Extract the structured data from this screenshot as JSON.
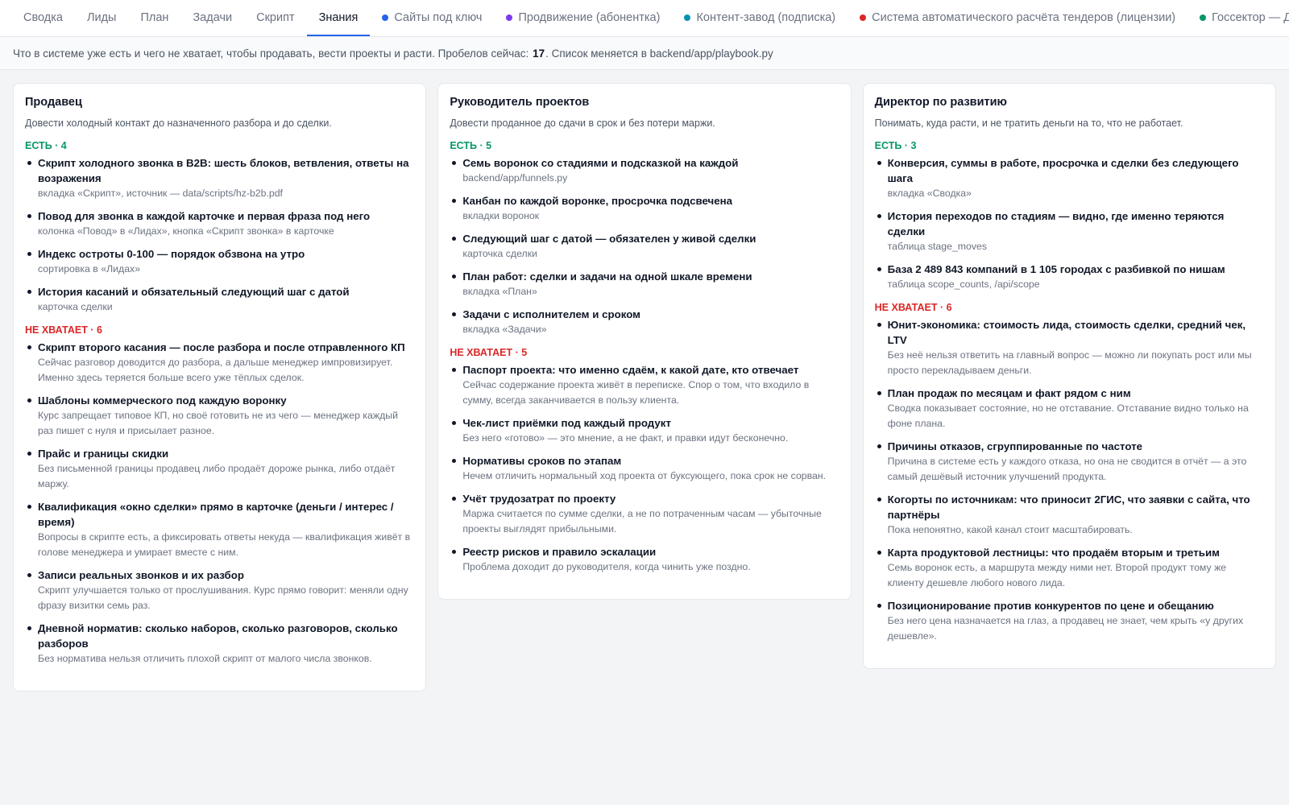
{
  "tabs": [
    {
      "label": "Сводка",
      "active": false
    },
    {
      "label": "Лиды",
      "active": false
    },
    {
      "label": "План",
      "active": false
    },
    {
      "label": "Задачи",
      "active": false
    },
    {
      "label": "Скрипт",
      "active": false
    },
    {
      "label": "Знания",
      "active": true
    },
    {
      "label": "Сайты под ключ",
      "dot": "#2563eb"
    },
    {
      "label": "Продвижение (абонентка)",
      "dot": "#7c3aed"
    },
    {
      "label": "Контент-завод (подписка)",
      "dot": "#0891b2"
    },
    {
      "label": "Система автоматического расчёта тендеров (лицензии)",
      "dot": "#dc2626"
    },
    {
      "label": "Госсектор — Дядя",
      "dot": "#059669"
    }
  ],
  "infobar": {
    "prefix": "Что в системе уже есть и чего не хватает, чтобы продавать, вести проекты и расти. Пробелов сейчас:",
    "gap_count": "17",
    "suffix": ". Список меняется в backend/app/playbook.py"
  },
  "colors": {
    "have": "#059669",
    "missing": "#dc2626",
    "active_tab": "#2563eb"
  },
  "roles": [
    {
      "title": "Продавец",
      "subtitle": "Довести холодный контакт до назначенного разбора и до сделки.",
      "have_label": "ЕСТЬ · 4",
      "have": [
        {
          "title": "Скрипт холодного звонка в B2B: шесть блоков, ветвления, ответы на возражения",
          "note": "вкладка «Скрипт», источник — data/scripts/hz-b2b.pdf"
        },
        {
          "title": "Повод для звонка в каждой карточке и первая фраза под него",
          "note": "колонка «Повод» в «Лидах», кнопка «Скрипт звонка» в карточке"
        },
        {
          "title": "Индекс остроты 0-100 — порядок обзвона на утро",
          "note": "сортировка в «Лидах»"
        },
        {
          "title": "История касаний и обязательный следующий шаг с датой",
          "note": "карточка сделки"
        }
      ],
      "missing_label": "НЕ ХВАТАЕТ · 6",
      "missing": [
        {
          "title": "Скрипт второго касания — после разбора и после отправленного КП",
          "note": "Сейчас разговор доводится до разбора, а дальше менеджер импровизирует. Именно здесь теряется больше всего уже тёплых сделок."
        },
        {
          "title": "Шаблоны коммерческого под каждую воронку",
          "note": "Курс запрещает типовое КП, но своё готовить не из чего — менеджер каждый раз пишет с нуля и присылает разное."
        },
        {
          "title": "Прайс и границы скидки",
          "note": "Без письменной границы продавец либо продаёт дороже рынка, либо отдаёт маржу."
        },
        {
          "title": "Квалификация «окно сделки» прямо в карточке (деньги / интерес / время)",
          "note": "Вопросы в скрипте есть, а фиксировать ответы некуда — квалификация живёт в голове менеджера и умирает вместе с ним."
        },
        {
          "title": "Записи реальных звонков и их разбор",
          "note": "Скрипт улучшается только от прослушивания. Курс прямо говорит: меняли одну фразу визитки семь раз."
        },
        {
          "title": "Дневной норматив: сколько наборов, сколько разговоров, сколько разборов",
          "note": "Без норматива нельзя отличить плохой скрипт от малого числа звонков."
        }
      ]
    },
    {
      "title": "Руководитель проектов",
      "subtitle": "Довести проданное до сдачи в срок и без потери маржи.",
      "have_label": "ЕСТЬ · 5",
      "have": [
        {
          "title": "Семь воронок со стадиями и подсказкой на каждой",
          "note": "backend/app/funnels.py"
        },
        {
          "title": "Канбан по каждой воронке, просрочка подсвечена",
          "note": "вкладки воронок"
        },
        {
          "title": "Следующий шаг с датой — обязателен у живой сделки",
          "note": "карточка сделки"
        },
        {
          "title": "План работ: сделки и задачи на одной шкале времени",
          "note": "вкладка «План»"
        },
        {
          "title": "Задачи с исполнителем и сроком",
          "note": "вкладка «Задачи»"
        }
      ],
      "missing_label": "НЕ ХВАТАЕТ · 5",
      "missing": [
        {
          "title": "Паспорт проекта: что именно сдаём, к какой дате, кто отвечает",
          "note": "Сейчас содержание проекта живёт в переписке. Спор о том, что входило в сумму, всегда заканчивается в пользу клиента."
        },
        {
          "title": "Чек-лист приёмки под каждый продукт",
          "note": "Без него «готово» — это мнение, а не факт, и правки идут бесконечно."
        },
        {
          "title": "Нормативы сроков по этапам",
          "note": "Нечем отличить нормальный ход проекта от буксующего, пока срок не сорван."
        },
        {
          "title": "Учёт трудозатрат по проекту",
          "note": "Маржа считается по сумме сделки, а не по потраченным часам — убыточные проекты выглядят прибыльными."
        },
        {
          "title": "Реестр рисков и правило эскалации",
          "note": "Проблема доходит до руководителя, когда чинить уже поздно."
        }
      ]
    },
    {
      "title": "Директор по развитию",
      "subtitle": "Понимать, куда расти, и не тратить деньги на то, что не работает.",
      "have_label": "ЕСТЬ · 3",
      "have": [
        {
          "title": "Конверсия, суммы в работе, просрочка и сделки без следующего шага",
          "note": "вкладка «Сводка»"
        },
        {
          "title": "История переходов по стадиям — видно, где именно теряются сделки",
          "note": "таблица stage_moves"
        },
        {
          "title": "База 2 489 843 компаний в 1 105 городах с разбивкой по нишам",
          "note": "таблица scope_counts, /api/scope"
        }
      ],
      "missing_label": "НЕ ХВАТАЕТ · 6",
      "missing": [
        {
          "title": "Юнит-экономика: стоимость лида, стоимость сделки, средний чек, LTV",
          "note": "Без неё нельзя ответить на главный вопрос — можно ли покупать рост или мы просто перекладываем деньги."
        },
        {
          "title": "План продаж по месяцам и факт рядом с ним",
          "note": "Сводка показывает состояние, но не отставание. Отставание видно только на фоне плана."
        },
        {
          "title": "Причины отказов, сгруппированные по частоте",
          "note": "Причина в системе есть у каждого отказа, но она не сводится в отчёт — а это самый дешёвый источник улучшений продукта."
        },
        {
          "title": "Когорты по источникам: что приносит 2ГИС, что заявки с сайта, что партнёры",
          "note": "Пока непонятно, какой канал стоит масштабировать."
        },
        {
          "title": "Карта продуктовой лестницы: что продаём вторым и третьим",
          "note": "Семь воронок есть, а маршрута между ними нет. Второй продукт тому же клиенту дешевле любого нового лида."
        },
        {
          "title": "Позиционирование против конкурентов по цене и обещанию",
          "note": "Без него цена назначается на глаз, а продавец не знает, чем крыть «у других дешевле»."
        }
      ]
    }
  ]
}
